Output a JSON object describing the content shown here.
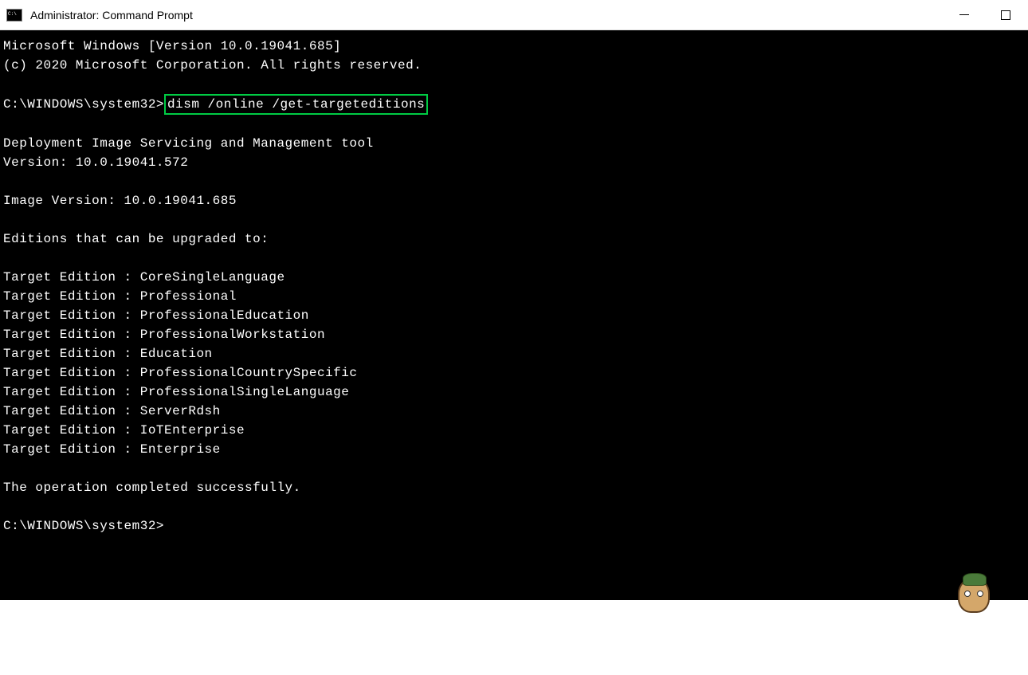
{
  "window": {
    "title": "Administrator: Command Prompt"
  },
  "terminal": {
    "line1": "Microsoft Windows [Version 10.0.19041.685]",
    "line2": "(c) 2020 Microsoft Corporation. All rights reserved.",
    "prompt1": "C:\\WINDOWS\\system32>",
    "command": "dism /online /get-targeteditions",
    "tool_name": "Deployment Image Servicing and Management tool",
    "tool_version": "Version: 10.0.19041.572",
    "image_version": "Image Version: 10.0.19041.685",
    "editions_header": "Editions that can be upgraded to:",
    "edition1": "Target Edition : CoreSingleLanguage",
    "edition2": "Target Edition : Professional",
    "edition3": "Target Edition : ProfessionalEducation",
    "edition4": "Target Edition : ProfessionalWorkstation",
    "edition5": "Target Edition : Education",
    "edition6": "Target Edition : ProfessionalCountrySpecific",
    "edition7": "Target Edition : ProfessionalSingleLanguage",
    "edition8": "Target Edition : ServerRdsh",
    "edition9": "Target Edition : IoTEnterprise",
    "edition10": "Target Edition : Enterprise",
    "completion": "The operation completed successfully.",
    "prompt2": "C:\\WINDOWS\\system32>"
  }
}
